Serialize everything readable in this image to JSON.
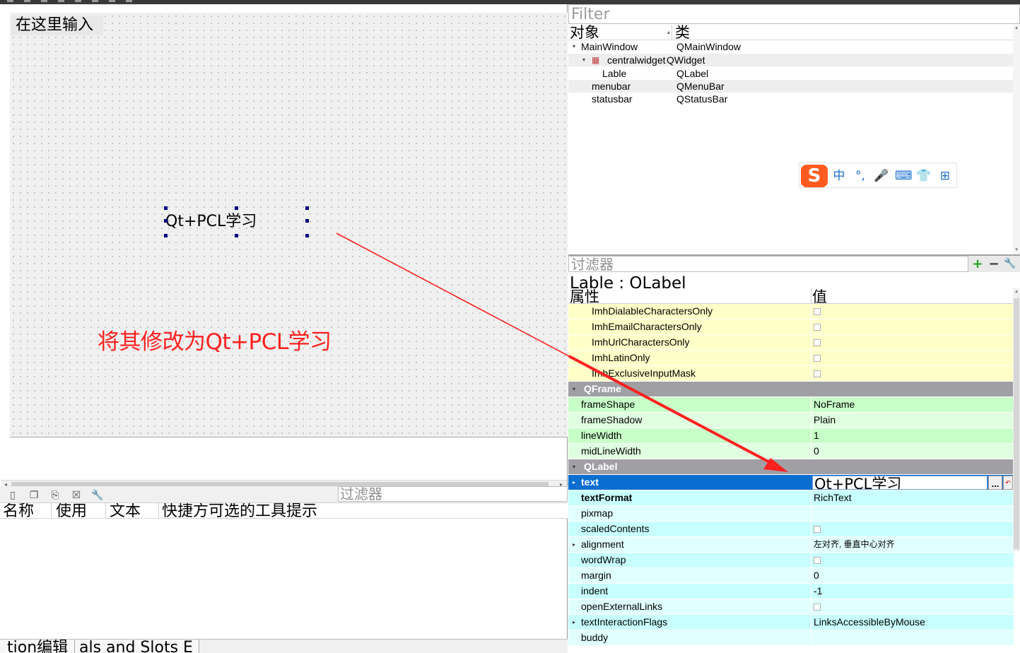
{
  "form": {
    "menubar_placeholder": "在这里输入",
    "label_text": "Qt+PCL学习",
    "annotation": "将其修改为Qt+PCL学习"
  },
  "action_editor": {
    "filter_placeholder": "过滤器",
    "columns": [
      "名称",
      "使用",
      "文本",
      "快捷方可选的工具提示"
    ],
    "tabs": [
      "tion编辑",
      "als and Slots E"
    ]
  },
  "object_inspector": {
    "filter_placeholder": "Filter",
    "col_object": "对象",
    "col_class": "类",
    "rows": [
      {
        "name": "MainWindow",
        "cls": "QMainWindow"
      },
      {
        "name": "centralwidget",
        "cls": "QWidget"
      },
      {
        "name": "Lable",
        "cls": "QLabel"
      },
      {
        "name": "menubar",
        "cls": "QMenuBar"
      },
      {
        "name": "statusbar",
        "cls": "QStatusBar"
      }
    ]
  },
  "ime": {
    "logo": "S",
    "items": [
      "中",
      "°,",
      "🎤",
      "⌨",
      "👕",
      "⊞"
    ]
  },
  "property_editor": {
    "filter_placeholder": "讨滤器",
    "object_title": "Lable : QLabel",
    "col_property": "属性",
    "col_value": "值",
    "rows": [
      {
        "name": "ImhDialableCharactersOnly",
        "value": ""
      },
      {
        "name": "ImhEmailCharactersOnly",
        "value": ""
      },
      {
        "name": "ImhUrlCharactersOnly",
        "value": ""
      },
      {
        "name": "ImhLatinOnly",
        "value": ""
      },
      {
        "name": "ImhExclusiveInputMask",
        "value": ""
      },
      {
        "name": "QFrame",
        "value": ""
      },
      {
        "name": "frameShape",
        "value": "NoFrame"
      },
      {
        "name": "frameShadow",
        "value": "Plain"
      },
      {
        "name": "lineWidth",
        "value": "1"
      },
      {
        "name": "midLineWidth",
        "value": "0"
      },
      {
        "name": "QLabel",
        "value": ""
      },
      {
        "name": "text",
        "value": "Qt+PCL学习"
      },
      {
        "name": "textFormat",
        "value": "RichText"
      },
      {
        "name": "pixmap",
        "value": ""
      },
      {
        "name": "scaledContents",
        "value": ""
      },
      {
        "name": "alignment",
        "value": "左对齐, 垂直中心对齐"
      },
      {
        "name": "wordWrap",
        "value": ""
      },
      {
        "name": "margin",
        "value": "0"
      },
      {
        "name": "indent",
        "value": "-1"
      },
      {
        "name": "openExternalLinks",
        "value": ""
      },
      {
        "name": "textInteractionFlags",
        "value": "LinksAccessibleByMouse"
      },
      {
        "name": "buddy",
        "value": ""
      }
    ],
    "editor_button": "...",
    "reset_button": "↶"
  },
  "colors": {
    "annotation": "#ff2020",
    "selection": "#0a6ed1",
    "qobject_rows": "#ffffc8",
    "qframe_rows": "#c8ffc8",
    "qlabel_rows": "#c8ffff",
    "section_header": "#a0a0a4"
  }
}
